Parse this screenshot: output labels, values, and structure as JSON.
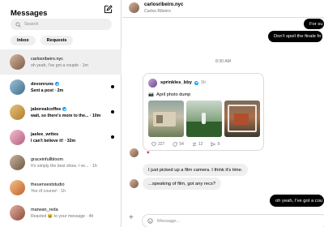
{
  "sidebar": {
    "title": "Messages",
    "search_placeholder": "Search",
    "tabs": [
      {
        "label": "Inbox"
      },
      {
        "label": "Requests"
      }
    ],
    "conversations": [
      {
        "name": "carlosribeiro.nyc",
        "preview": "oh yeah, I've got a couple · 1m",
        "verified": false,
        "unread": false,
        "selected": true
      },
      {
        "name": "devonruns",
        "preview": "Sent a post · 2m",
        "verified": true,
        "unread": true,
        "selected": false
      },
      {
        "name": "jaborealcoffee",
        "preview": "wait, so there's more to the... · 10m",
        "verified": true,
        "unread": true,
        "selected": false
      },
      {
        "name": "jaelee_writes",
        "preview": "I can't believe it! · 32m",
        "verified": false,
        "unread": true,
        "selected": false
      },
      {
        "name": "graceinfullbloom",
        "preview": "It's simply the best show. I ve... · 1h",
        "verified": false,
        "unread": false,
        "selected": false
      },
      {
        "name": "theuenseststudio",
        "preview": "Yes of course! · 1h",
        "verified": false,
        "unread": false,
        "selected": false
      },
      {
        "name": "marwan_reda",
        "preview": "Reacted 😆 to your message · 4h",
        "verified": false,
        "unread": false,
        "selected": false
      }
    ]
  },
  "chat": {
    "header": {
      "name": "carlosribeiro.nyc",
      "subtitle": "Carlos Ribeiro"
    },
    "outgoing_top_1": "For su",
    "outgoing_top_2": "Don't spoil the finale fo",
    "time_separator": "8:30 AM",
    "shared_post": {
      "username": "sprinkles_bby",
      "time": "1h",
      "caption_emoji": "📷",
      "caption": "April photo dump",
      "stats": {
        "likes": "227",
        "comments": "54",
        "reposts": "12",
        "shares": "9"
      }
    },
    "reaction": "♥",
    "incoming_1": "I just picked up a film camera. I think it's time.",
    "incoming_2": "...speaking of film, got any recs?",
    "outgoing_bottom": "oh yeah, I've got a cou",
    "composer_placeholder": "Message..."
  },
  "colors": {
    "accent": "#3797f0",
    "verified": "#0095f6",
    "heart": "#e0245e"
  }
}
